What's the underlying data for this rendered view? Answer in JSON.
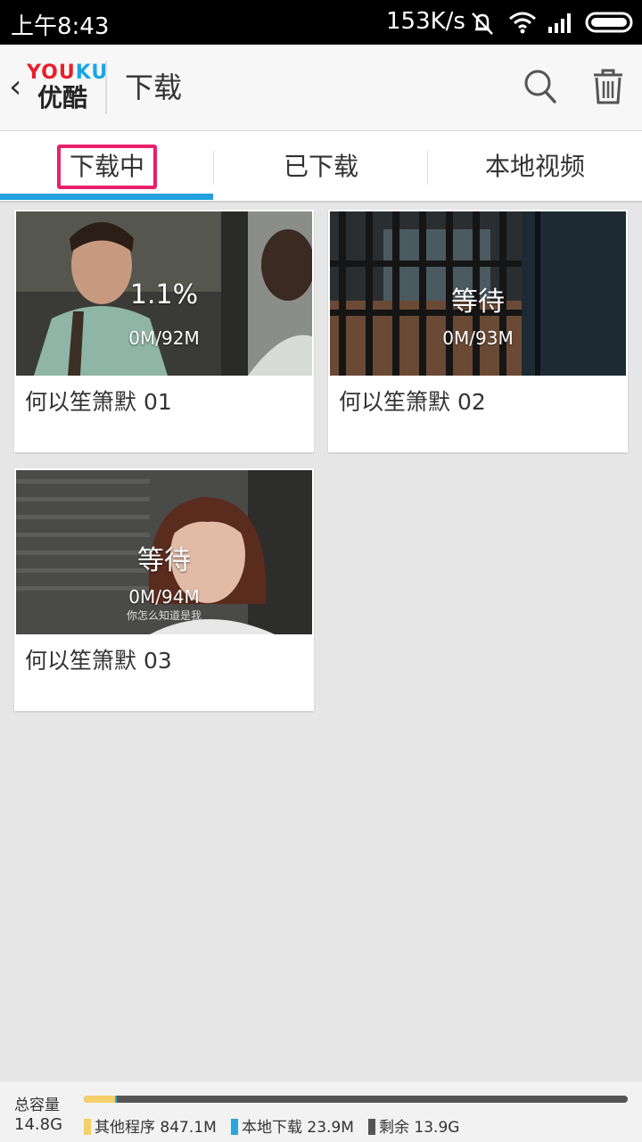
{
  "status_bar": {
    "time": "上午8:43",
    "net_speed": "153K/s",
    "icons": [
      "mute-vibrate-icon",
      "wifi-icon",
      "signal-icon",
      "battery-icon"
    ]
  },
  "header": {
    "logo_text": "YOUKU",
    "logo_cn": "优酷",
    "title": "下载",
    "icons": [
      "back-icon",
      "search-icon",
      "trash-icon"
    ]
  },
  "tabs": [
    {
      "label": "下载中",
      "active": true
    },
    {
      "label": "已下载",
      "active": false
    },
    {
      "label": "本地视频",
      "active": false
    }
  ],
  "videos": [
    {
      "title": "何以笙箫默 01",
      "status": "1.1%",
      "size": "0M/92M",
      "subtitle": ""
    },
    {
      "title": "何以笙箫默 02",
      "status": "等待",
      "size": "0M/93M",
      "subtitle": ""
    },
    {
      "title": "何以笙箫默 03",
      "status": "等待",
      "size": "0M/94M",
      "subtitle": "你怎么知道是我"
    }
  ],
  "storage": {
    "label": "总容量",
    "total": "14.8G",
    "other_label": "其他程序 847.1M",
    "local_label": "本地下载 23.9M",
    "free_label": "剩余 13.9G",
    "other_fraction": 0.057,
    "local_fraction": 0.002,
    "colors": {
      "other": "#f5cf6a",
      "local": "#2aa6df",
      "free": "#555555"
    }
  },
  "colors": {
    "accent_blue": "#22a0e0",
    "highlight_red": "#e8206a"
  }
}
